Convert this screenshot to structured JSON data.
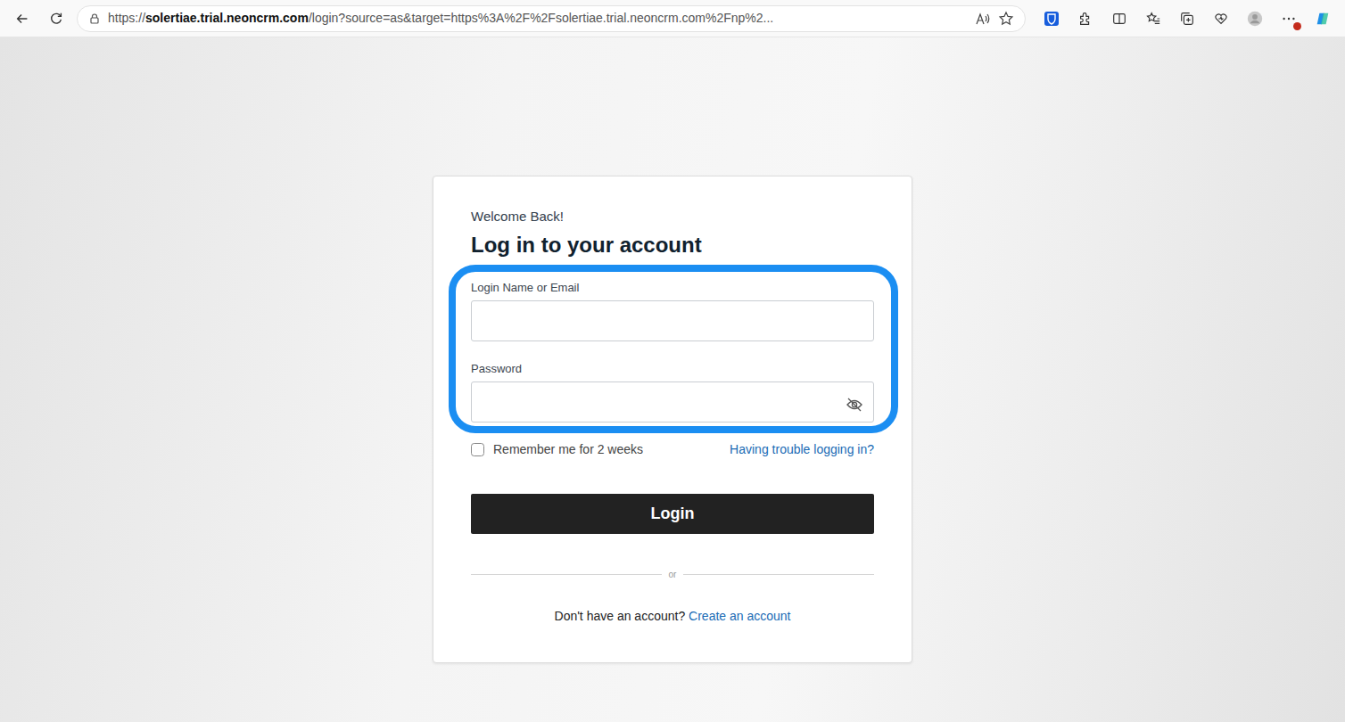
{
  "browser": {
    "url_scheme": "https://",
    "url_host": "solertiae.trial.neoncrm.com",
    "url_rest": "/login?source=as&target=https%3A%2F%2Fsolertiae.trial.neoncrm.com%2Fnp%2...",
    "alert": true
  },
  "form": {
    "greeting": "Welcome Back!",
    "title": "Log in to your account",
    "highlight": true,
    "fields": [
      {
        "label": "Login Name or Email",
        "value": ""
      },
      {
        "label": "Password",
        "value": "",
        "revealed": false
      }
    ],
    "remember": {
      "label": "Remember me for 2 weeks",
      "checked": false
    },
    "trouble_link": "Having trouble logging in?",
    "login_button": "Login",
    "divider": "or",
    "signup_prompt": "Don't have an account?",
    "signup_link": "Create an account"
  }
}
